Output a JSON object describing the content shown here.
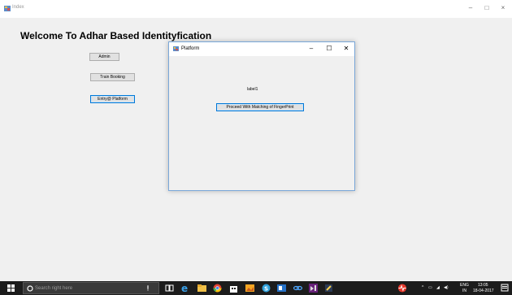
{
  "window": {
    "title": "Index",
    "minimize": "–",
    "maximize": "□",
    "close": "×"
  },
  "heading": "Welcome To Adhar Based Identityfication",
  "buttons": {
    "admin": "Admin",
    "train_booking": "Train Booking",
    "entry_platform": "Entry@ Platform"
  },
  "dialog": {
    "title": "Platform",
    "minimize": "–",
    "maximize": "☐",
    "close": "✕",
    "label": "label1",
    "proceed": "Proceed With Matching of FingerPrint"
  },
  "taskbar": {
    "search_placeholder": "Search right here",
    "language_top": "ENG",
    "language_bottom": "IN",
    "time": "13:05",
    "date": "18-04-2017"
  },
  "colors": {
    "accent": "#0078d7",
    "taskbar": "#1c1c1c"
  }
}
